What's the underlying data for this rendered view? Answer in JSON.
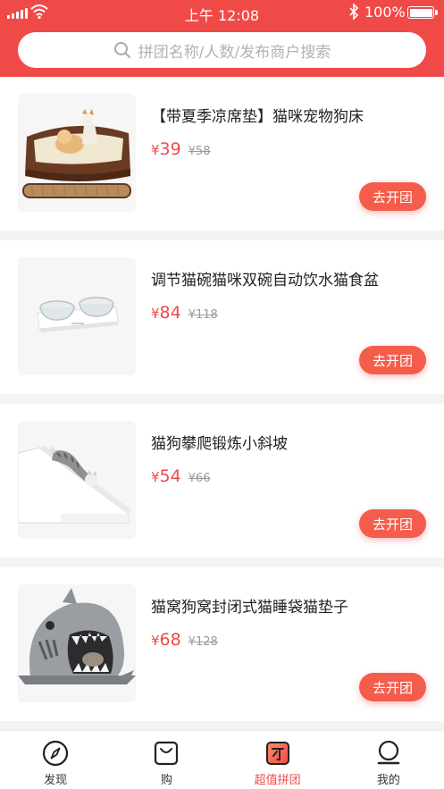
{
  "status_bar": {
    "time": "上午 12:08",
    "battery": "100%"
  },
  "search": {
    "placeholder": "拼团名称/人数/发布商户搜索"
  },
  "products": [
    {
      "title": "【带夏季凉席垫】猫咪宠物狗床",
      "price": "39",
      "original_price": "¥58",
      "action": "去开团",
      "image": "pet-bed-image"
    },
    {
      "title": "调节猫碗猫咪双碗自动饮水猫食盆",
      "price": "84",
      "original_price": "¥118",
      "action": "去开团",
      "image": "double-bowl-image"
    },
    {
      "title": "猫狗攀爬锻炼小斜坡",
      "price": "54",
      "original_price": "¥66",
      "action": "去开团",
      "image": "pet-ramp-image"
    },
    {
      "title": "猫窝狗窝封闭式猫睡袋猫垫子",
      "price": "68",
      "original_price": "¥128",
      "action": "去开团",
      "image": "shark-cat-bed-image"
    }
  ],
  "currency_symbol": "¥",
  "tabs": [
    {
      "label": "发现",
      "icon": "compass-icon"
    },
    {
      "label": "购",
      "icon": "bag-icon"
    },
    {
      "label": "超值拼团",
      "icon": "group-buy-icon",
      "active": true
    },
    {
      "label": "我的",
      "icon": "profile-icon"
    }
  ],
  "colors": {
    "brand_red": "#f04a48",
    "button_red": "#f45d4c",
    "price_red": "#f04a48",
    "muted_text": "#9a9a9a"
  }
}
